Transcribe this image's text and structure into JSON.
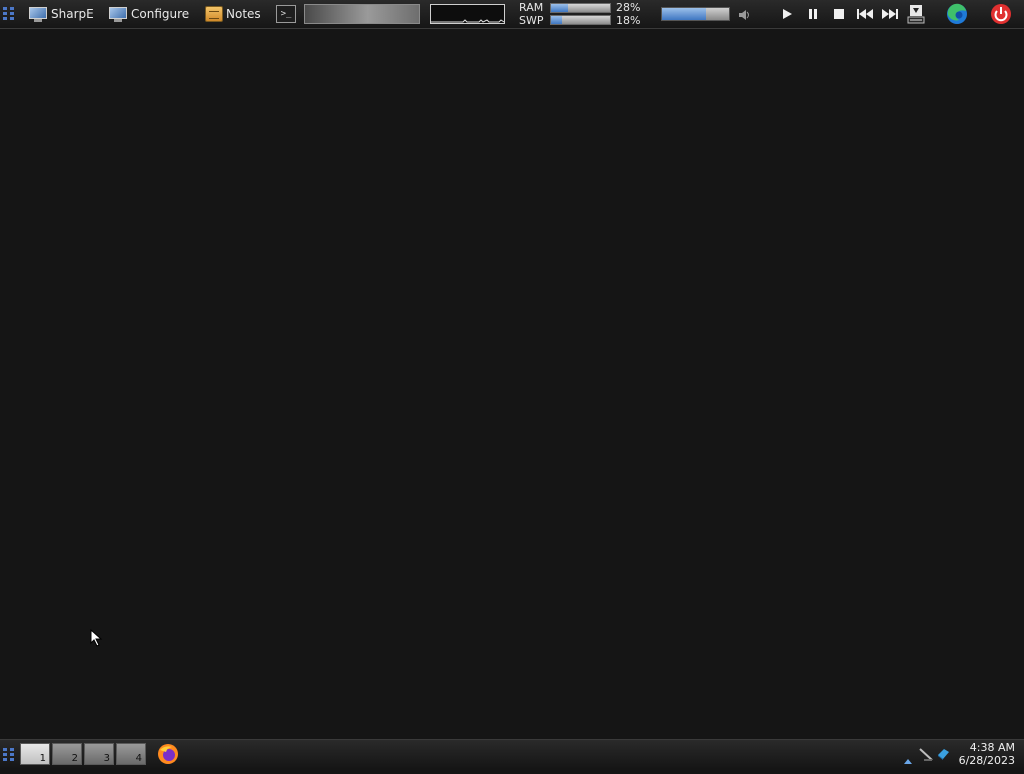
{
  "top_bar": {
    "launchers": [
      {
        "label": "SharpE",
        "icon": "monitor-icon"
      },
      {
        "label": "Configure",
        "icon": "monitor-icon"
      },
      {
        "label": "Notes",
        "icon": "notes-icon"
      }
    ],
    "terminal_icon_text": ">_",
    "ram": {
      "label": "RAM",
      "value": "28%",
      "fraction": 0.28
    },
    "swap": {
      "label": "SWP",
      "value": "18%",
      "fraction": 0.18
    },
    "volume": {
      "fraction": 0.66,
      "icon": "speaker-icon"
    },
    "media_controls": [
      "play-icon",
      "pause-icon",
      "stop-icon",
      "previous-icon",
      "next-icon"
    ],
    "accent_color": "#3f77c2",
    "power_color": "#e03030"
  },
  "bottom_bar": {
    "workspaces": [
      "1",
      "2",
      "3",
      "4"
    ],
    "active_workspace": "1",
    "clock": {
      "time": "4:38 AM",
      "date": "6/28/2023"
    }
  }
}
